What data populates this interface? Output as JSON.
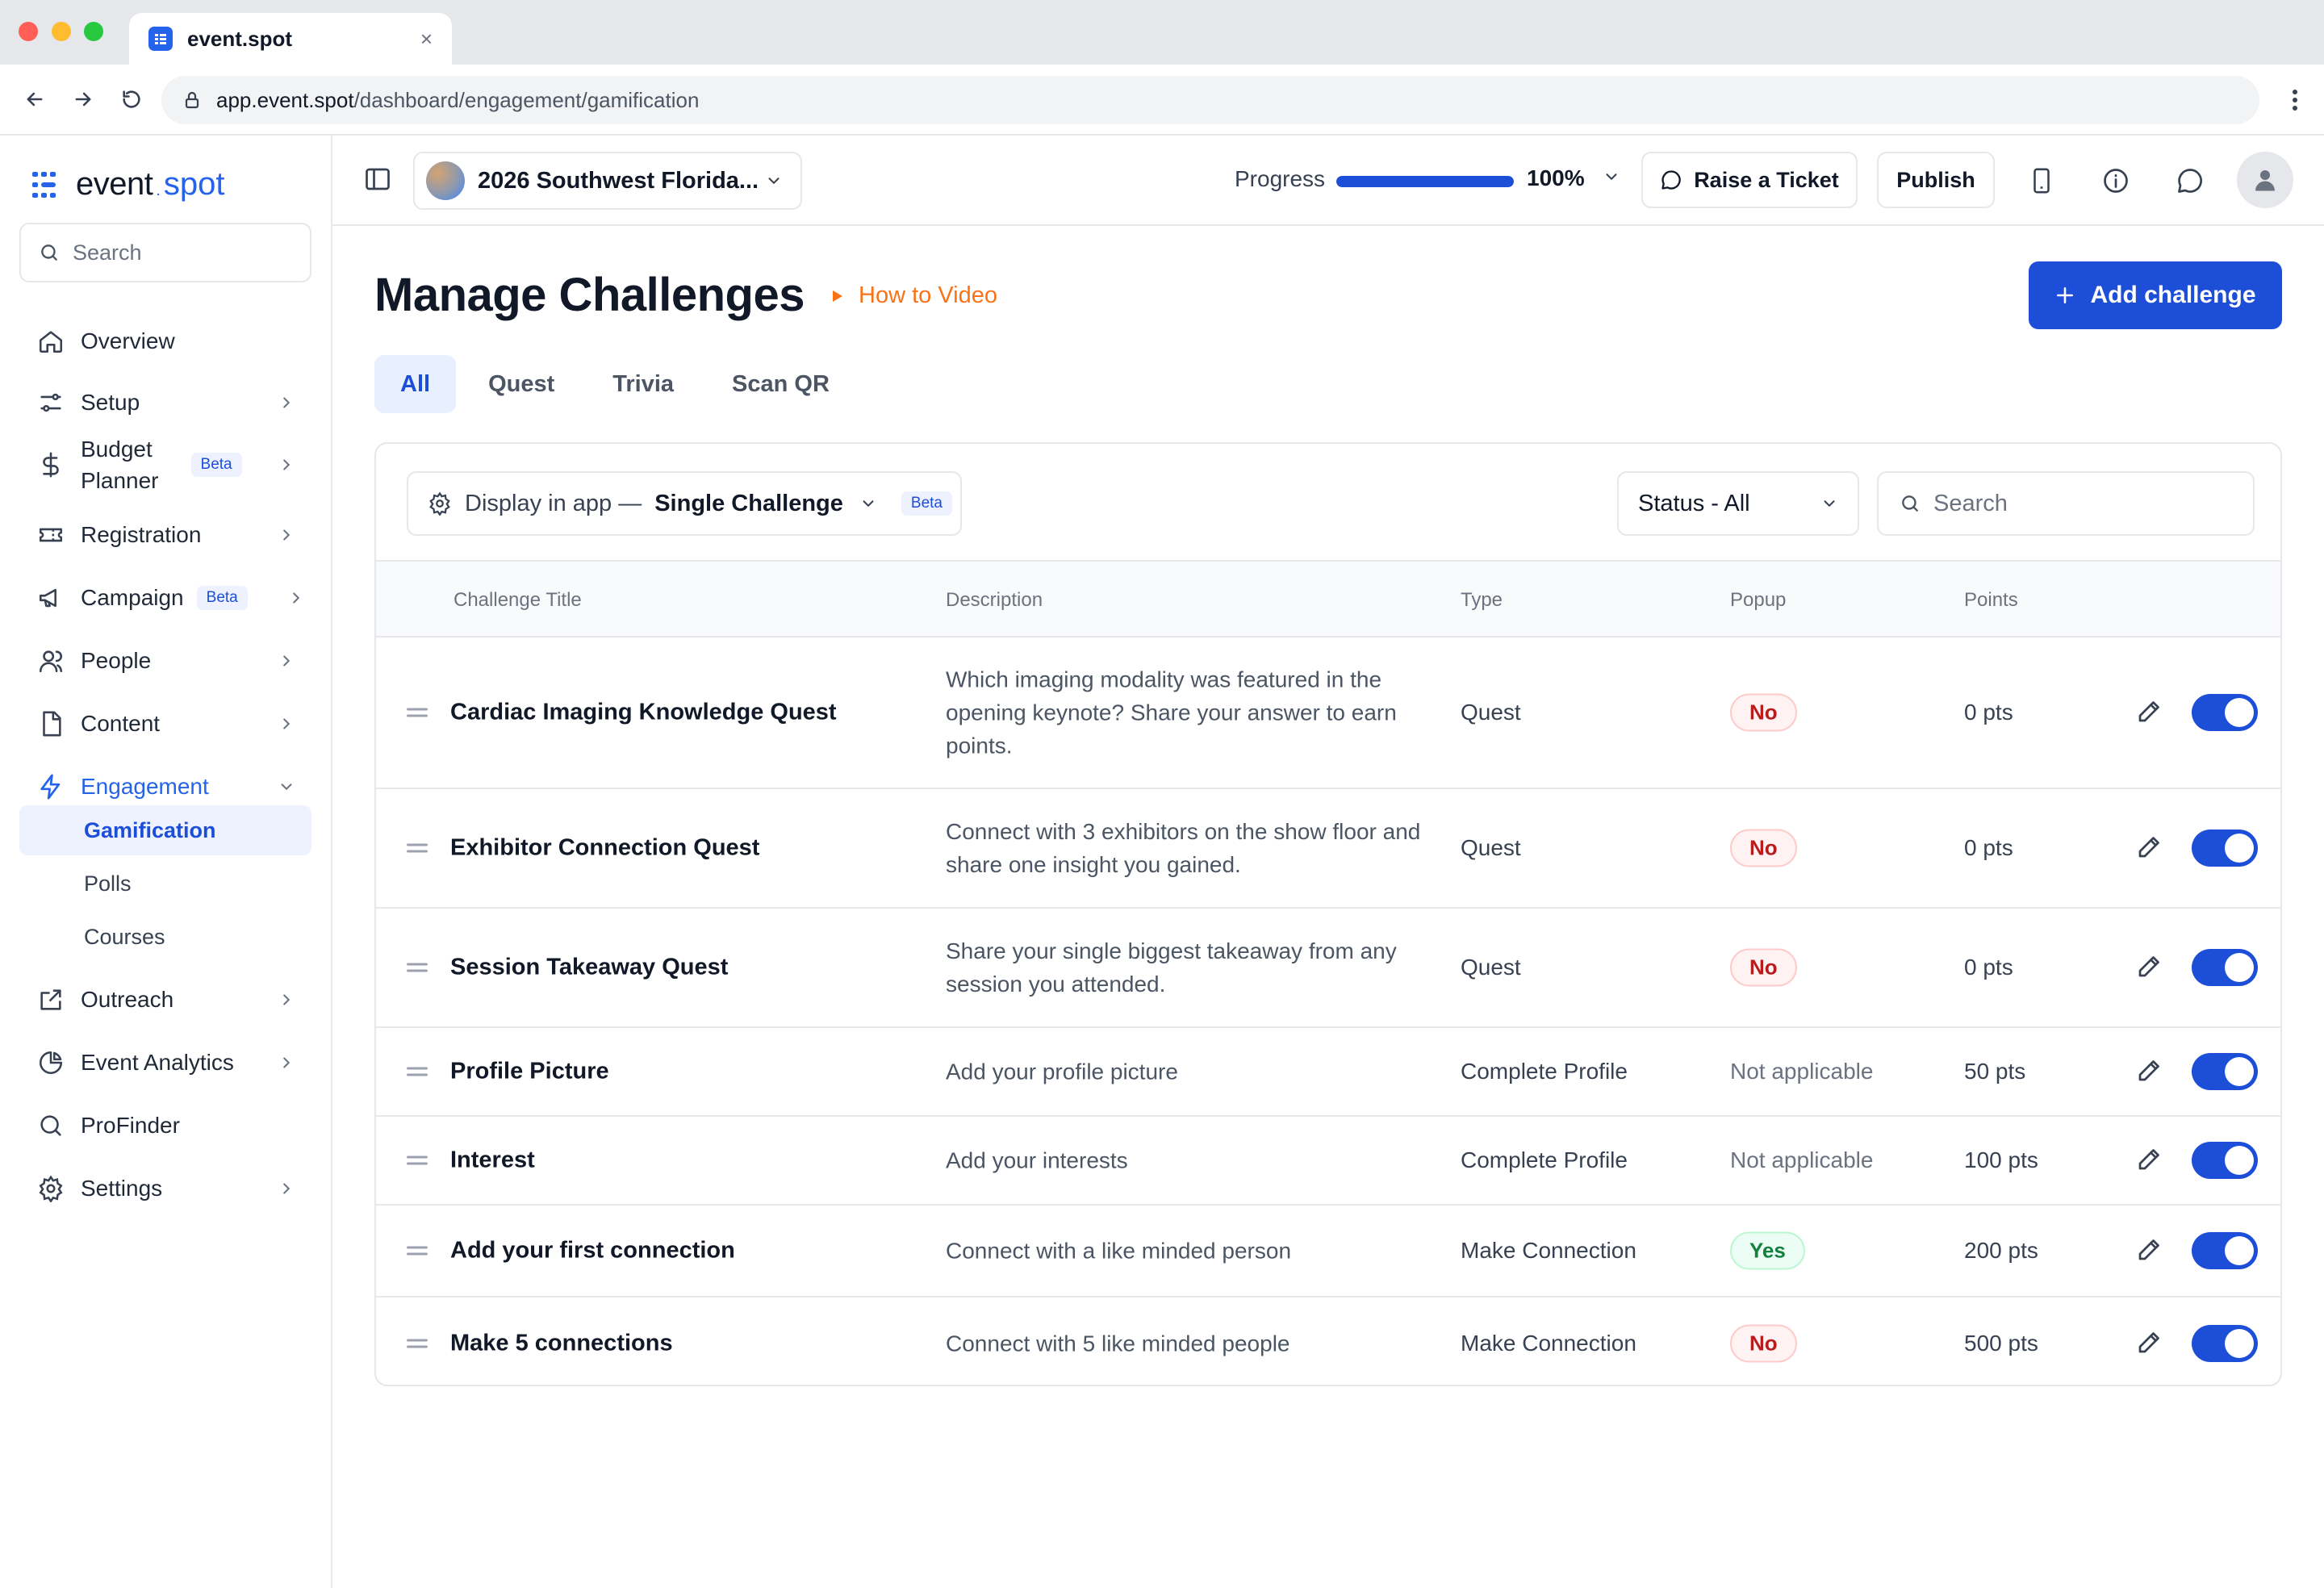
{
  "browser": {
    "tab_title": "event.spot",
    "url_domain": "app.event.spot",
    "url_path": "/dashboard/engagement/gamification"
  },
  "sidebar": {
    "logo_part1": "event",
    "logo_dot": ".",
    "logo_part2": "spot",
    "search_placeholder": "Search",
    "items": [
      {
        "label": "Overview",
        "icon": "home-icon"
      },
      {
        "label": "Setup",
        "icon": "sliders-icon"
      },
      {
        "label": "Budget Planner",
        "icon": "dollar-icon",
        "badge": "Beta"
      },
      {
        "label": "Registration",
        "icon": "ticket-icon"
      },
      {
        "label": "Campaign",
        "icon": "megaphone-icon",
        "badge": "Beta"
      },
      {
        "label": "People",
        "icon": "users-icon"
      },
      {
        "label": "Content",
        "icon": "file-icon"
      },
      {
        "label": "Engagement",
        "icon": "bolt-icon"
      },
      {
        "label": "Outreach",
        "icon": "share-icon"
      },
      {
        "label": "Event Analytics",
        "icon": "pie-chart-icon"
      },
      {
        "label": "ProFinder",
        "icon": "search-icon"
      },
      {
        "label": "Settings",
        "icon": "gear-icon"
      }
    ],
    "budget_line1": "Budget",
    "budget_line2": "Planner",
    "sub_items": [
      {
        "label": "Gamification"
      },
      {
        "label": "Polls"
      },
      {
        "label": "Courses"
      }
    ]
  },
  "topbar": {
    "event_name": "2026 Southwest Florida...",
    "progress_label": "Progress",
    "progress_value": 1.0,
    "progress_text": "100%",
    "raise_ticket": "Raise a Ticket",
    "publish": "Publish"
  },
  "main": {
    "title": "Manage Challenges",
    "how_to": "How to Video",
    "add_button": "Add challenge",
    "tabs": [
      "All",
      "Quest",
      "Trivia",
      "Scan QR"
    ],
    "display_label": "Display in app —",
    "display_value": "Single Challenge",
    "display_badge": "Beta",
    "status_filter": "Status - All",
    "search_placeholder": "Search",
    "columns": [
      "Challenge Title",
      "Description",
      "Type",
      "Popup",
      "Points"
    ]
  },
  "colors": {
    "accent": "#1d4ed8",
    "how_to": "#f97316",
    "no_badge": "#b91c1c",
    "yes_badge": "#15803d"
  },
  "rows": [
    {
      "title": "Cardiac Imaging Knowledge Quest",
      "description": "Which imaging modality was featured in the opening keynote? Share your answer to earn points.",
      "type": "Quest",
      "popup": "No",
      "points": "0 pts",
      "enabled": true
    },
    {
      "title": "Exhibitor Connection Quest",
      "description": "Connect with 3 exhibitors on the show floor and share one insight you gained.",
      "type": "Quest",
      "popup": "No",
      "points": "0 pts",
      "enabled": true
    },
    {
      "title": "Session Takeaway Quest",
      "description": "Share your single biggest takeaway from any session you attended.",
      "type": "Quest",
      "popup": "No",
      "points": "0 pts",
      "enabled": true
    },
    {
      "title": "Profile Picture",
      "description": "Add your profile picture",
      "type": "Complete Profile",
      "popup": "Not applicable",
      "points": "50 pts",
      "enabled": true
    },
    {
      "title": "Interest",
      "description": "Add your interests",
      "type": "Complete Profile",
      "popup": "Not applicable",
      "points": "100 pts",
      "enabled": true
    },
    {
      "title": "Add your first connection",
      "description": "Connect with a like minded person",
      "type": "Make Connection",
      "popup": "Yes",
      "points": "200 pts",
      "enabled": true
    },
    {
      "title": "Make 5 connections",
      "description": "Connect with 5 like minded people",
      "type": "Make Connection",
      "popup": "No",
      "points": "500 pts",
      "enabled": true
    }
  ]
}
